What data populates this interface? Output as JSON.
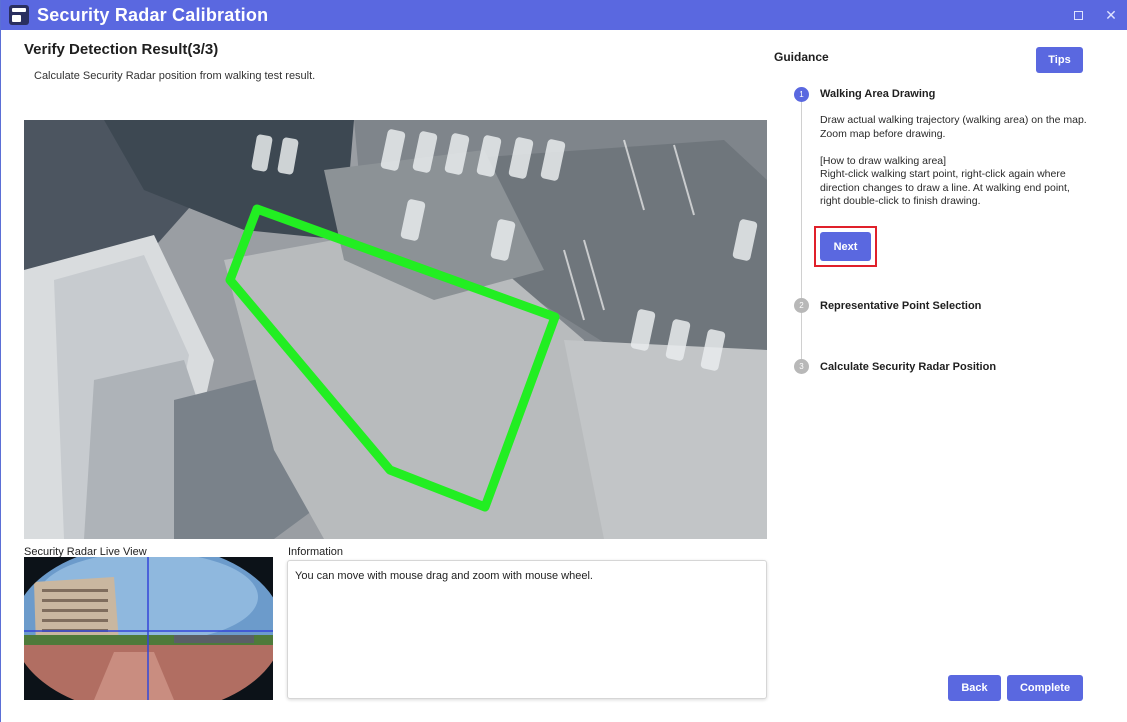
{
  "window": {
    "title": "Security Radar Calibration",
    "maximize_icon": "maximize-icon",
    "close_icon": "close-icon",
    "close_glyph": "✕"
  },
  "header": {
    "title": "Verify Detection Result(3/3)",
    "subtitle": "Calculate Security Radar position from walking test result."
  },
  "live_view": {
    "label": "Security Radar Live View"
  },
  "information": {
    "label": "Information",
    "text": "You can move with mouse drag and zoom with mouse wheel."
  },
  "guidance": {
    "title": "Guidance",
    "tips_label": "Tips",
    "steps": [
      {
        "number": "1",
        "label": "Walking Area Drawing",
        "desc1": "Draw actual walking trajectory (walking area) on the map. Zoom map before drawing.",
        "desc2": "[How to draw walking area]",
        "desc3": "Right-click walking start point, right-click again where direction changes to draw a line. At walking end point, right double-click to finish drawing.",
        "next_label": "Next"
      },
      {
        "number": "2",
        "label": "Representative Point Selection"
      },
      {
        "number": "3",
        "label": "Calculate Security Radar Position"
      }
    ]
  },
  "footer": {
    "back_label": "Back",
    "complete_label": "Complete"
  },
  "colors": {
    "accent": "#5a68e0",
    "highlight_border": "#e0202a",
    "walking_area": "#22ee22",
    "step_inactive": "#b8b8b8"
  }
}
